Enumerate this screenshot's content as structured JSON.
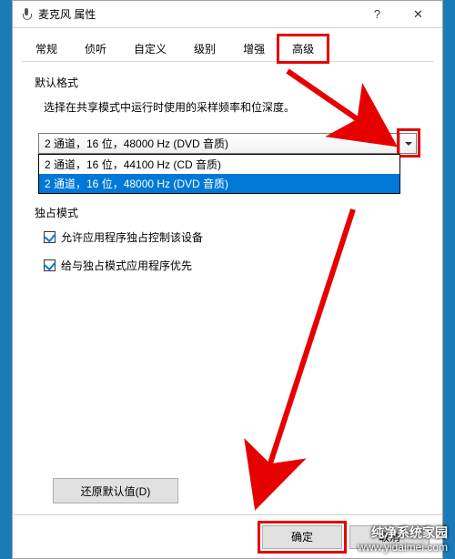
{
  "window": {
    "title": "麦克风 属性"
  },
  "tabs": [
    {
      "label": "常规"
    },
    {
      "label": "侦听"
    },
    {
      "label": "自定义"
    },
    {
      "label": "级别"
    },
    {
      "label": "增强"
    },
    {
      "label": "高级",
      "active": true
    }
  ],
  "default_format": {
    "group_label": "默认格式",
    "desc": "选择在共享模式中运行时使用的采样频率和位深度。",
    "selected": "2 通道，16 位，48000 Hz (DVD 音质)",
    "options": [
      "2 通道，16 位，44100 Hz (CD 音质)",
      "2 通道，16 位，48000 Hz (DVD 音质)"
    ]
  },
  "exclusive_mode": {
    "group_label": "独占模式",
    "allow_exclusive": "允许应用程序独占控制该设备",
    "priority": "给与独占模式应用程序优先"
  },
  "buttons": {
    "restore": "还原默认值(D)",
    "ok": "确定",
    "cancel": "取消"
  },
  "watermark": {
    "title": "纯净系统家园",
    "url": "www.yidaimei.com"
  }
}
